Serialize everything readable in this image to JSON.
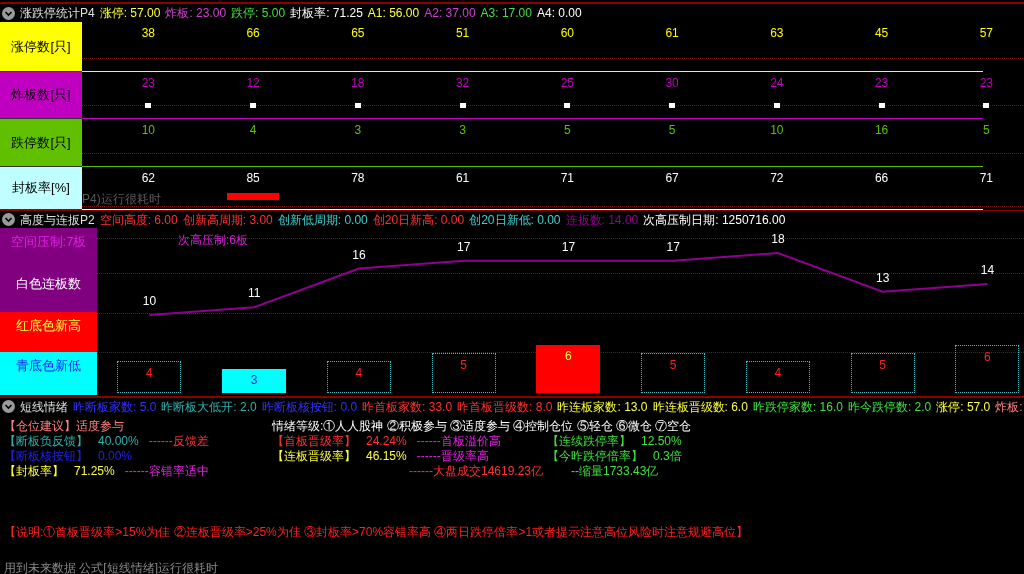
{
  "panel_stats": {
    "title": "涨跌停统计P4",
    "header_items": [
      {
        "text": "涨停: 57.00",
        "color": "#ffff40"
      },
      {
        "text": "炸板: 23.00",
        "color": "#d040d0"
      },
      {
        "text": "跌停: 5.00",
        "color": "#40e040"
      },
      {
        "text": "封板率: 71.25",
        "color": "#ffffff"
      },
      {
        "text": "A1: 56.00",
        "color": "#ffff40"
      },
      {
        "text": "A2: 37.00",
        "color": "#d040d0"
      },
      {
        "text": "A3: 17.00",
        "color": "#40e040"
      },
      {
        "text": "A4: 0.00",
        "color": "#ffffff"
      }
    ],
    "rows": [
      {
        "label": "涨停数[只]",
        "color": "#ffff00",
        "values": [
          "38",
          "66",
          "65",
          "51",
          "60",
          "61",
          "63",
          "45",
          "57"
        ]
      },
      {
        "label": "炸板数[只]",
        "color": "#c000c0",
        "values": [
          "23",
          "12",
          "18",
          "32",
          "25",
          "30",
          "24",
          "23",
          "23"
        ]
      },
      {
        "label": "跌停数[只]",
        "color": "#60c000",
        "values": [
          "10",
          "4",
          "3",
          "3",
          "5",
          "5",
          "10",
          "16",
          "5"
        ]
      },
      {
        "label": "封板率[%]",
        "color": "#c0ffff",
        "values": [
          "62",
          "85",
          "78",
          "61",
          "71",
          "67",
          "72",
          "66",
          "71"
        ]
      }
    ],
    "flags": [
      false,
      true,
      false,
      false,
      false,
      false,
      false,
      false,
      false
    ],
    "note": "P4)运行很耗时"
  },
  "panel_height": {
    "title": "高度与连扳P2",
    "header_items": [
      {
        "text": "空间高度: 6.00",
        "kind": "high"
      },
      {
        "text": "创新高周期: 3.00",
        "kind": "high"
      },
      {
        "text": "创新低周期: 0.00",
        "kind": "low"
      },
      {
        "text": "创20日新高: 0.00",
        "kind": "high"
      },
      {
        "text": "创20日新低: 0.00",
        "kind": "low"
      },
      {
        "text": "连扳数: 14.00",
        "kind": "count"
      },
      {
        "text": "次高压制日期: 1250716.00",
        "kind": "date"
      }
    ],
    "legend": [
      {
        "text": "空间压制:7板",
        "kind": "title"
      },
      {
        "text": "白色连板数",
        "kind": "body"
      },
      {
        "text": "红底色新高",
        "kind": "high"
      },
      {
        "text": "青底色新低",
        "kind": "low"
      }
    ],
    "second_resistance": "次高压制:6板",
    "chart_data": {
      "type": "line",
      "series": [
        {
          "color": "#900090",
          "values": [
            10,
            11,
            16,
            17,
            17,
            17,
            18,
            13,
            14
          ]
        }
      ],
      "data_labels": true
    },
    "bars": [
      {
        "value": "4",
        "kind": "normal"
      },
      {
        "value": "3",
        "kind": "new_low"
      },
      {
        "value": "4",
        "kind": "normal"
      },
      {
        "value": "5",
        "kind": "normal"
      },
      {
        "value": "6",
        "kind": "new_high"
      },
      {
        "value": "5",
        "kind": "normal"
      },
      {
        "value": "4",
        "kind": "normal"
      },
      {
        "value": "5",
        "kind": "normal"
      },
      {
        "value": "6",
        "kind": "normal"
      }
    ]
  },
  "panel_mood": {
    "title": "短线情绪",
    "header_items": [
      {
        "text": "昨断板家数: 5.0",
        "color": "#3030ff"
      },
      {
        "text": "昨断板大低开: 2.0",
        "color": "#30b0b0"
      },
      {
        "text": "昨断板核按钮: 0.0",
        "color": "#3030ff"
      },
      {
        "text": "昨首板家数: 33.0",
        "color": "#ff3030"
      },
      {
        "text": "昨首板晋级数: 8.0",
        "color": "#ff3030"
      },
      {
        "text": "昨连板家数: 13.0",
        "color": "#ffff40"
      },
      {
        "text": "昨连板晋级数: 6.0",
        "color": "#ffff40"
      },
      {
        "text": "昨跌停家数: 16.0",
        "color": "#40e040"
      },
      {
        "text": "昨今跌停数: 2.0",
        "color": "#40e040"
      },
      {
        "text": "涨停: 57.0",
        "color": "#ffff40"
      },
      {
        "text": "炸板:",
        "color": "#ff8080"
      }
    ],
    "advice": {
      "label": "【仓位建议】",
      "value": "适度参与"
    },
    "levels": "情绪等级:①人人股神 ②积极参与 ③适度参与 ④控制仓位 ⑤轻仓 ⑥微仓 ⑦空仓",
    "columns": [
      [
        {
          "label": "【断板负反馈】",
          "value": "40.00%",
          "comment": {
            "text": "------反馈差",
            "kind": "warning"
          },
          "color": "#30b0b0"
        },
        {
          "label": "【断板核按钮】",
          "value": "0.00%",
          "color": "#2020e0"
        },
        {
          "label": "【封板率】",
          "value": "71.25%",
          "comment": {
            "text": "------容错率适中",
            "kind": "remark"
          },
          "color": "#ffff40"
        }
      ],
      [
        {
          "label": "【首板晋级率】",
          "value": "24.24%",
          "comment": {
            "text": "------首板溢价高",
            "kind": "remark"
          },
          "color": "#ff3030"
        },
        {
          "label": "【连板晋级率】",
          "value": "46.15%",
          "comment": {
            "text": "------晋级率高",
            "kind": "remark"
          },
          "color": "#ffff40"
        },
        {
          "comment": {
            "text": "------大盘成交14619.23亿",
            "kind": "warning"
          }
        }
      ],
      [
        {
          "label": "【连续跌停率】",
          "value": "12.50%",
          "color": "#40e040"
        },
        {
          "label": "【今昨跌停倍率】",
          "value": "0.3倍",
          "color": "#40e040"
        },
        {
          "comment": {
            "text": "--缩量1733.43亿",
            "kind": "positive"
          }
        }
      ]
    ],
    "explanation": "【说明:①首板晋级率>15%为佳 ②连板晋级率>25%为佳 ③封板率>70%容错率高 ④两日跌停倍率>1或者提示注意高位风险时注意规避高位】",
    "status": "用到未来数据 公式[短线情绪]运行很耗时"
  }
}
